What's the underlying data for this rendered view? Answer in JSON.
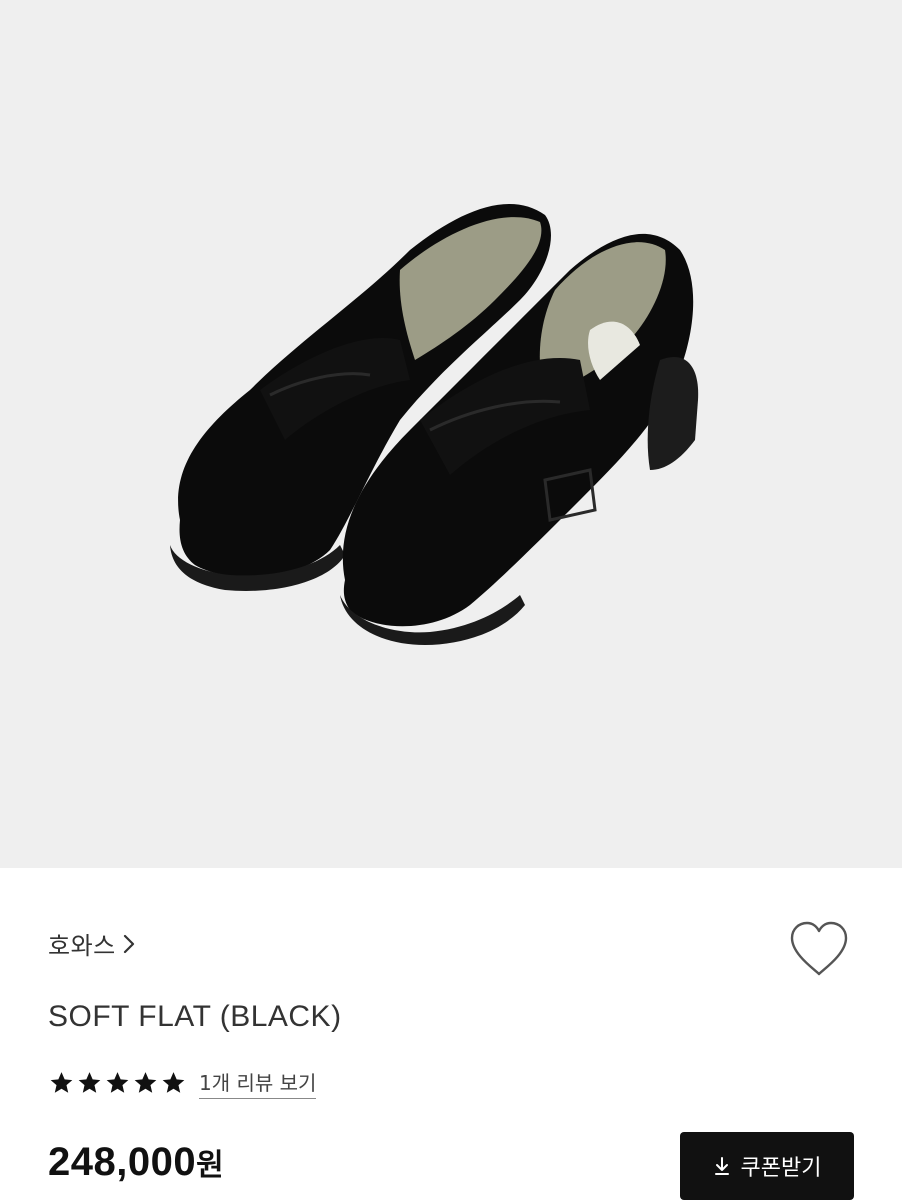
{
  "product": {
    "brand": "호와스",
    "name": "SOFT FLAT (BLACK)",
    "rating": 5,
    "review_link": "1개 리뷰 보기",
    "price": "248,000",
    "price_unit": "원"
  },
  "actions": {
    "coupon_label": "쿠폰받기"
  },
  "icons": {
    "wishlist": "heart-outline-icon",
    "brand_chevron": "chevron-right-icon",
    "coupon": "download-icon",
    "star": "star-filled-icon"
  },
  "colors": {
    "image_background": "#efefef",
    "button_background": "#111111",
    "text_primary": "#222222"
  }
}
